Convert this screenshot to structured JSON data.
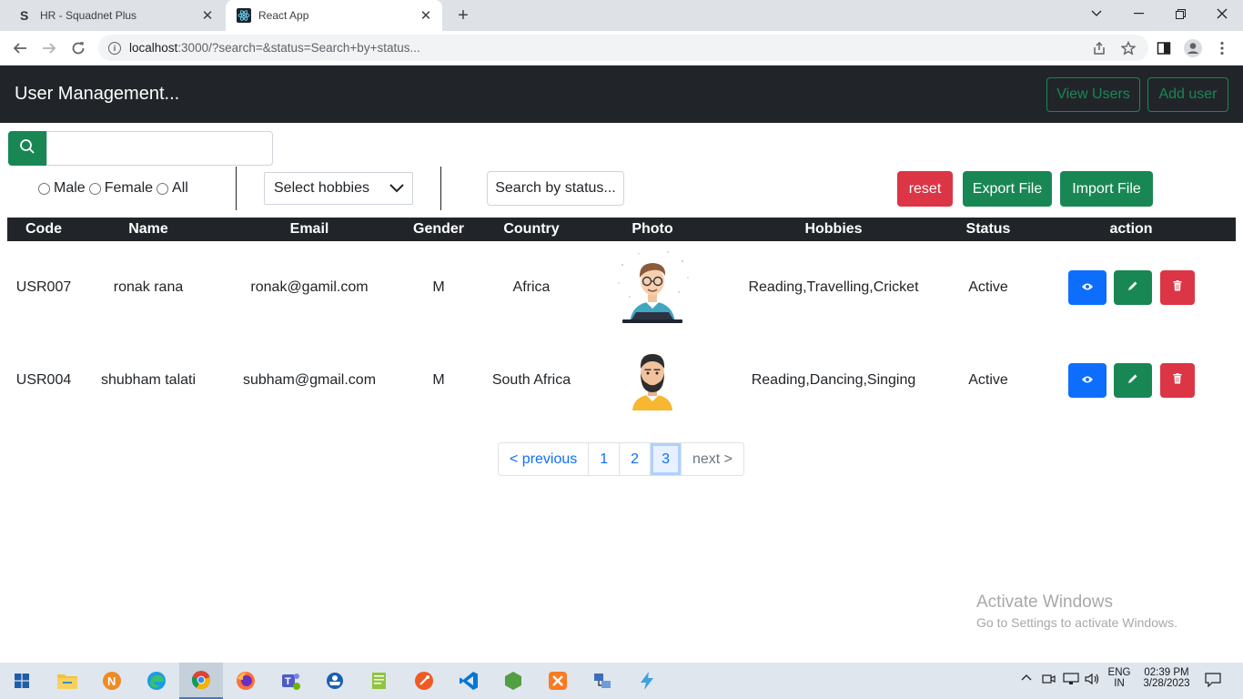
{
  "browser": {
    "tabs": [
      {
        "title": "HR - Squadnet Plus",
        "icon": "squadnet-logo-icon"
      },
      {
        "title": "React App",
        "icon": "react-logo-icon"
      }
    ],
    "url_main": "localhost",
    "url_rest": ":3000/?search=&status=Search+by+status..."
  },
  "navbar": {
    "brand": "User Management...",
    "view_users": "View Users",
    "add_user": "Add user"
  },
  "filters": {
    "search_value": "",
    "gender_options": [
      "Male",
      "Female",
      "All"
    ],
    "hobbies_select": "Select hobbies",
    "status_search": "Search by status...",
    "reset": "reset",
    "export": "Export File",
    "import": "Import File"
  },
  "table": {
    "headers": [
      "Code",
      "Name",
      "Email",
      "Gender",
      "Country",
      "Photo",
      "Hobbies",
      "Status",
      "action"
    ],
    "rows": [
      {
        "code": "USR007",
        "name": "ronak rana",
        "email": "ronak@gamil.com",
        "gender": "M",
        "country": "Africa",
        "photo": "avatar-laptop-man",
        "hobbies": "Reading,Travelling,Cricket",
        "status": "Active"
      },
      {
        "code": "USR004",
        "name": "shubham talati",
        "email": "subham@gmail.com",
        "gender": "M",
        "country": "South Africa",
        "photo": "avatar-bearded-man",
        "hobbies": "Reading,Dancing,Singing",
        "status": "Active"
      }
    ]
  },
  "pagination": {
    "items": [
      "< previous",
      "1",
      "2",
      "3",
      "next >"
    ],
    "active": "3"
  },
  "watermark": {
    "title": "Activate Windows",
    "subtitle": "Go to Settings to activate Windows."
  },
  "taskbar": {
    "lang_top": "ENG",
    "lang_bottom": "IN",
    "time": "02:39 PM",
    "date": "3/28/2023"
  },
  "colors": {
    "navbar_bg": "#212529",
    "success": "#198754",
    "danger": "#dc3545",
    "primary": "#0d6efd"
  }
}
